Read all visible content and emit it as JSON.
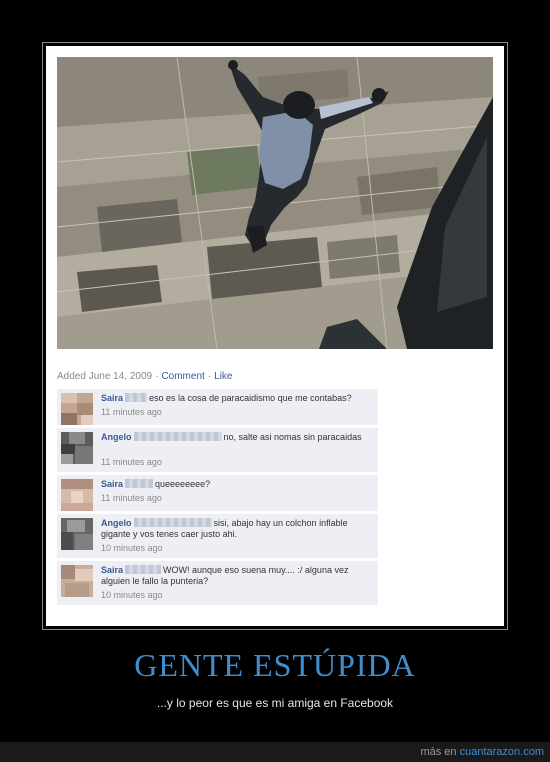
{
  "post": {
    "meta": {
      "added": "Added June 14, 2009",
      "comment_link": "Comment",
      "like_link": "Like",
      "separator": "·"
    },
    "comments": [
      {
        "name": "Saira",
        "text": "eso es la cosa de paracaidismo que me contabas?",
        "time": "11 minutes ago"
      },
      {
        "name": "Angelo",
        "text": "no, salte asi nomas sin paracaidas",
        "time": "11 minutes ago"
      },
      {
        "name": "Saira",
        "text": "queeeeeeee?",
        "time": "11 minutes ago"
      },
      {
        "name": "Angelo",
        "text": "sisi, abajo hay un colchon inflable gigante y vos tenes caer justo ahi.",
        "time": "10 minutes ago"
      },
      {
        "name": "Saira",
        "text": "WOW! aunque eso suena muy.... :/ alguna vez alguien le fallo la punteria?",
        "time": "10 minutes ago"
      }
    ]
  },
  "headline": "GENTE ESTÚPIDA",
  "subtitle": "...y lo peor es que es mi amiga en Facebook",
  "footer": {
    "prefix": "más en ",
    "brand": "cuantarazon.com"
  },
  "colors": {
    "accent": "#3f8fd0",
    "link": "#3b5998",
    "comment_bg": "#edeff4"
  }
}
